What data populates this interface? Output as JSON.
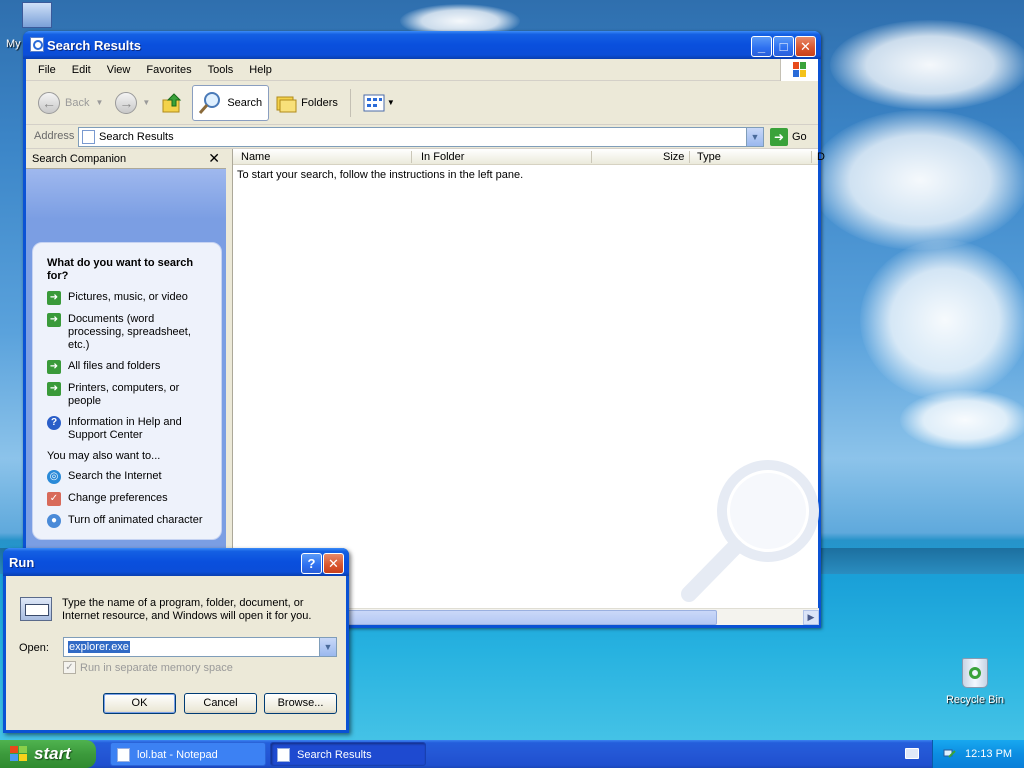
{
  "desktop": {
    "icon_mycomputer": "My",
    "icon_recycle": "Recycle Bin"
  },
  "window": {
    "title": "Search Results",
    "menu": [
      "File",
      "Edit",
      "View",
      "Favorites",
      "Tools",
      "Help"
    ],
    "toolbar": {
      "back": "Back",
      "search": "Search",
      "folders": "Folders"
    },
    "address": {
      "label": "Address",
      "value": "Search Results",
      "go": "Go"
    },
    "left_pane": {
      "header": "Search Companion",
      "question": "What do you want to search for?",
      "options": [
        "Pictures, music, or video",
        "Documents (word processing, spreadsheet, etc.)",
        "All files and folders",
        "Printers, computers, or people",
        "Information in Help and Support Center"
      ],
      "also_label": "You may also want to...",
      "also": [
        "Search the Internet",
        "Change preferences",
        "Turn off animated character"
      ]
    },
    "columns": {
      "name": "Name",
      "in_folder": "In Folder",
      "size": "Size",
      "type": "Type",
      "cut": "D"
    },
    "hint": "To start your search, follow the instructions in the left pane."
  },
  "run": {
    "title": "Run",
    "help_btn": "?",
    "description": "Type the name of a program, folder, document, or Internet resource, and Windows will open it for you.",
    "open_label": "Open:",
    "open_value": "explorer.exe",
    "checkbox": "Run in separate memory space",
    "ok": "OK",
    "cancel": "Cancel",
    "browse": "Browse..."
  },
  "taskbar": {
    "start": "start",
    "tasks": [
      "lol.bat - Notepad",
      "Search Results"
    ],
    "clock": "12:13 PM"
  }
}
